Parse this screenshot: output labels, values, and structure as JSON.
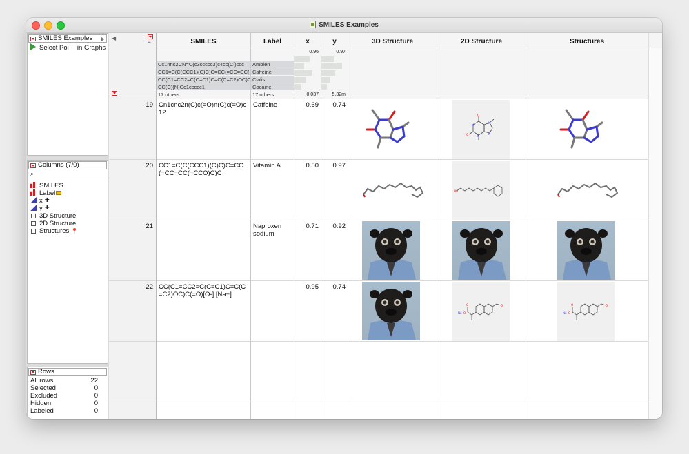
{
  "window": {
    "title": "SMILES Examples"
  },
  "table_panel": {
    "name": "SMILES Examples",
    "script": "Select Poi… in Graphs"
  },
  "columns_panel": {
    "header": "Columns (7/0)",
    "search_placeholder": "",
    "items": [
      {
        "name": "SMILES",
        "type": "nominal"
      },
      {
        "name": "Label",
        "type": "nominal"
      },
      {
        "name": "x",
        "type": "continuous"
      },
      {
        "name": "y",
        "type": "continuous"
      },
      {
        "name": "3D Structure",
        "type": "expression"
      },
      {
        "name": "2D Structure",
        "type": "expression"
      },
      {
        "name": "Structures",
        "type": "expression"
      }
    ]
  },
  "rows_panel": {
    "header": "Rows",
    "stats": [
      {
        "label": "All rows",
        "value": "22"
      },
      {
        "label": "Selected",
        "value": "0"
      },
      {
        "label": "Excluded",
        "value": "0"
      },
      {
        "label": "Hidden",
        "value": "0"
      },
      {
        "label": "Labeled",
        "value": "0"
      }
    ]
  },
  "grid": {
    "headers": {
      "smiles": "SMILES",
      "label": "Label",
      "x": "x",
      "y": "y",
      "d3": "3D Structure",
      "d2": "2D Structure",
      "structures": "Structures"
    },
    "summary": {
      "smiles": [
        "Cc1nnc2CN=C(c3ccccc3)c4cc(Cl)ccc",
        "CC1=C(C(CCC1)(C)C)C=CC(=CC=CC(",
        "CC(C1=CC2=C(C=C1)C=C(C=C2)OC)C",
        "CC(C)(N)Cc1ccccc1",
        "17 others"
      ],
      "label": [
        "Ambien",
        "Caffeine",
        "Cialis",
        "Cocaine",
        "17 others"
      ],
      "x": {
        "max": "0.96",
        "min": "0.037"
      },
      "y": {
        "max": "0.97",
        "min": "5.32m"
      }
    },
    "rows": [
      {
        "n": "19",
        "smiles": "Cn1cnc2n(C)c(=O)n(C)c(=O)c12",
        "label": "Caffeine",
        "x": "0.69",
        "y": "0.74"
      },
      {
        "n": "20",
        "smiles": "CC1=C(C(CCC1)(C)C)C=CC(=CC=CC(=CCO)C)C",
        "label": "Vitamin A",
        "x": "0.50",
        "y": "0.97"
      },
      {
        "n": "21",
        "smiles": "",
        "label": "Naproxen sodium",
        "x": "0.71",
        "y": "0.92"
      },
      {
        "n": "22",
        "smiles": "CC(C1=CC2=C(C=C1)C=C(C=C2)OC)C(=O)[O-].[Na+]",
        "label": "",
        "x": "0.95",
        "y": "0.74"
      }
    ]
  }
}
